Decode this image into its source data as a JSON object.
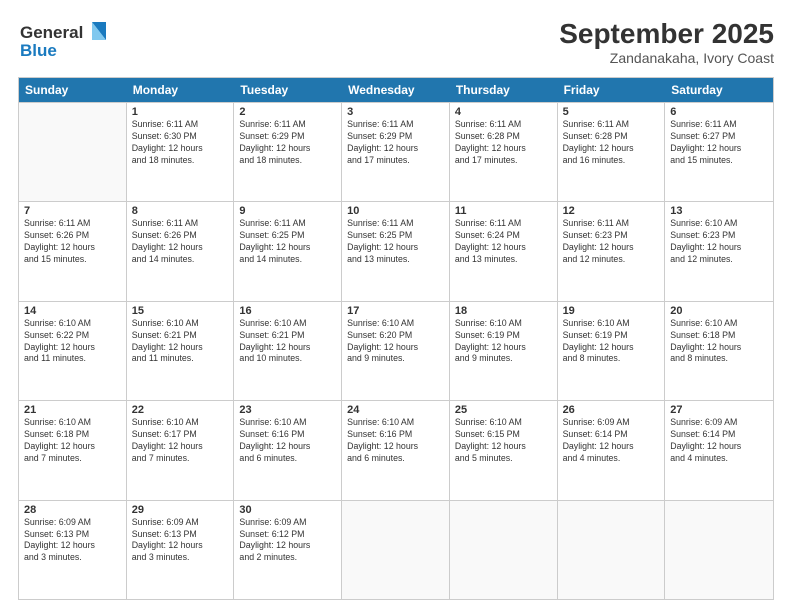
{
  "header": {
    "logo_line1": "General",
    "logo_line2": "Blue",
    "title": "September 2025",
    "subtitle": "Zandanakaha, Ivory Coast"
  },
  "days_of_week": [
    "Sunday",
    "Monday",
    "Tuesday",
    "Wednesday",
    "Thursday",
    "Friday",
    "Saturday"
  ],
  "weeks": [
    [
      {
        "num": "",
        "info": ""
      },
      {
        "num": "1",
        "info": "Sunrise: 6:11 AM\nSunset: 6:30 PM\nDaylight: 12 hours\nand 18 minutes."
      },
      {
        "num": "2",
        "info": "Sunrise: 6:11 AM\nSunset: 6:29 PM\nDaylight: 12 hours\nand 18 minutes."
      },
      {
        "num": "3",
        "info": "Sunrise: 6:11 AM\nSunset: 6:29 PM\nDaylight: 12 hours\nand 17 minutes."
      },
      {
        "num": "4",
        "info": "Sunrise: 6:11 AM\nSunset: 6:28 PM\nDaylight: 12 hours\nand 17 minutes."
      },
      {
        "num": "5",
        "info": "Sunrise: 6:11 AM\nSunset: 6:28 PM\nDaylight: 12 hours\nand 16 minutes."
      },
      {
        "num": "6",
        "info": "Sunrise: 6:11 AM\nSunset: 6:27 PM\nDaylight: 12 hours\nand 15 minutes."
      }
    ],
    [
      {
        "num": "7",
        "info": "Sunrise: 6:11 AM\nSunset: 6:26 PM\nDaylight: 12 hours\nand 15 minutes."
      },
      {
        "num": "8",
        "info": "Sunrise: 6:11 AM\nSunset: 6:26 PM\nDaylight: 12 hours\nand 14 minutes."
      },
      {
        "num": "9",
        "info": "Sunrise: 6:11 AM\nSunset: 6:25 PM\nDaylight: 12 hours\nand 14 minutes."
      },
      {
        "num": "10",
        "info": "Sunrise: 6:11 AM\nSunset: 6:25 PM\nDaylight: 12 hours\nand 13 minutes."
      },
      {
        "num": "11",
        "info": "Sunrise: 6:11 AM\nSunset: 6:24 PM\nDaylight: 12 hours\nand 13 minutes."
      },
      {
        "num": "12",
        "info": "Sunrise: 6:11 AM\nSunset: 6:23 PM\nDaylight: 12 hours\nand 12 minutes."
      },
      {
        "num": "13",
        "info": "Sunrise: 6:10 AM\nSunset: 6:23 PM\nDaylight: 12 hours\nand 12 minutes."
      }
    ],
    [
      {
        "num": "14",
        "info": "Sunrise: 6:10 AM\nSunset: 6:22 PM\nDaylight: 12 hours\nand 11 minutes."
      },
      {
        "num": "15",
        "info": "Sunrise: 6:10 AM\nSunset: 6:21 PM\nDaylight: 12 hours\nand 11 minutes."
      },
      {
        "num": "16",
        "info": "Sunrise: 6:10 AM\nSunset: 6:21 PM\nDaylight: 12 hours\nand 10 minutes."
      },
      {
        "num": "17",
        "info": "Sunrise: 6:10 AM\nSunset: 6:20 PM\nDaylight: 12 hours\nand 9 minutes."
      },
      {
        "num": "18",
        "info": "Sunrise: 6:10 AM\nSunset: 6:19 PM\nDaylight: 12 hours\nand 9 minutes."
      },
      {
        "num": "19",
        "info": "Sunrise: 6:10 AM\nSunset: 6:19 PM\nDaylight: 12 hours\nand 8 minutes."
      },
      {
        "num": "20",
        "info": "Sunrise: 6:10 AM\nSunset: 6:18 PM\nDaylight: 12 hours\nand 8 minutes."
      }
    ],
    [
      {
        "num": "21",
        "info": "Sunrise: 6:10 AM\nSunset: 6:18 PM\nDaylight: 12 hours\nand 7 minutes."
      },
      {
        "num": "22",
        "info": "Sunrise: 6:10 AM\nSunset: 6:17 PM\nDaylight: 12 hours\nand 7 minutes."
      },
      {
        "num": "23",
        "info": "Sunrise: 6:10 AM\nSunset: 6:16 PM\nDaylight: 12 hours\nand 6 minutes."
      },
      {
        "num": "24",
        "info": "Sunrise: 6:10 AM\nSunset: 6:16 PM\nDaylight: 12 hours\nand 6 minutes."
      },
      {
        "num": "25",
        "info": "Sunrise: 6:10 AM\nSunset: 6:15 PM\nDaylight: 12 hours\nand 5 minutes."
      },
      {
        "num": "26",
        "info": "Sunrise: 6:09 AM\nSunset: 6:14 PM\nDaylight: 12 hours\nand 4 minutes."
      },
      {
        "num": "27",
        "info": "Sunrise: 6:09 AM\nSunset: 6:14 PM\nDaylight: 12 hours\nand 4 minutes."
      }
    ],
    [
      {
        "num": "28",
        "info": "Sunrise: 6:09 AM\nSunset: 6:13 PM\nDaylight: 12 hours\nand 3 minutes."
      },
      {
        "num": "29",
        "info": "Sunrise: 6:09 AM\nSunset: 6:13 PM\nDaylight: 12 hours\nand 3 minutes."
      },
      {
        "num": "30",
        "info": "Sunrise: 6:09 AM\nSunset: 6:12 PM\nDaylight: 12 hours\nand 2 minutes."
      },
      {
        "num": "",
        "info": ""
      },
      {
        "num": "",
        "info": ""
      },
      {
        "num": "",
        "info": ""
      },
      {
        "num": "",
        "info": ""
      }
    ]
  ]
}
